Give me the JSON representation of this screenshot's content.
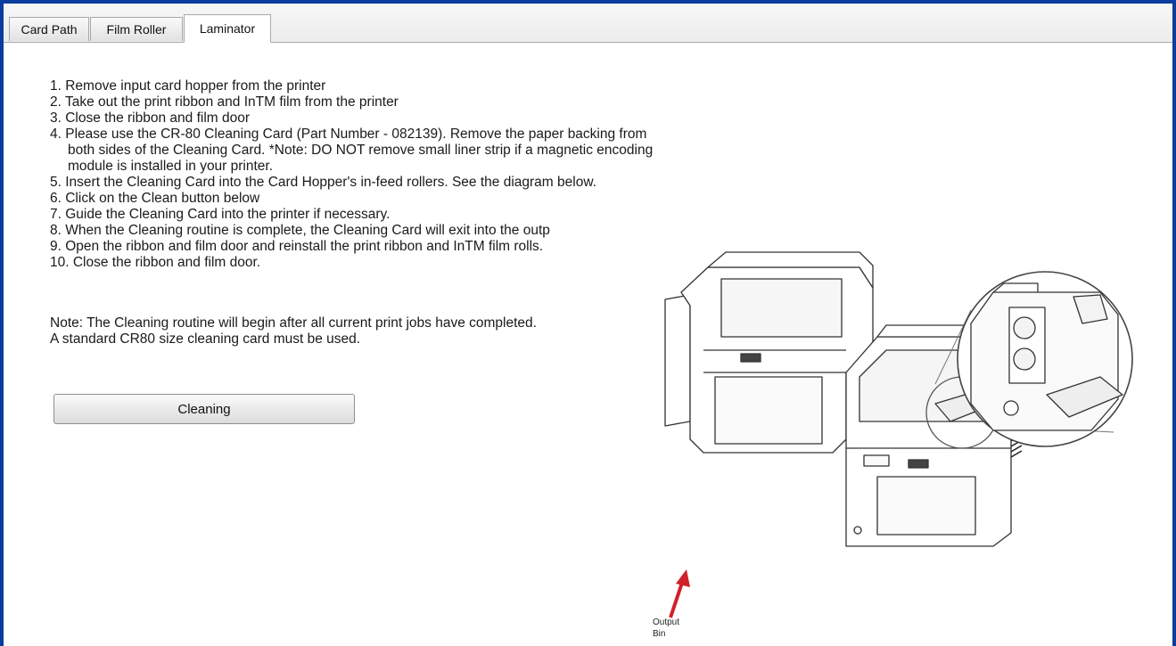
{
  "tabs": [
    {
      "label": "Card Path"
    },
    {
      "label": "Film Roller"
    },
    {
      "label": "Laminator"
    }
  ],
  "active_tab": "Laminator",
  "instructions": {
    "steps": [
      "1. Remove input card hopper from the printer",
      "2. Take out the print ribbon and InTM film from the printer",
      "3. Close the ribbon and film door",
      "4. Please use the CR-80 Cleaning Card (Part Number - 082139). Remove the paper backing from",
      "both sides of the Cleaning Card. *Note: DO NOT remove small liner strip if a magnetic encoding",
      "module is installed in your printer.",
      "5. Insert the Cleaning Card into the Card Hopper's in-feed rollers. See the diagram below.",
      "6. Click on the Clean button below",
      "7. Guide the Cleaning Card into the printer if necessary.",
      "8. When the Cleaning routine is complete, the Cleaning Card will exit into the outp",
      "9. Open the ribbon and film door and reinstall the print ribbon and InTM film rolls.",
      "10. Close the ribbon and film door."
    ],
    "note_line1": "Note: The Cleaning routine will begin after all current print jobs have completed.",
    "note_line2": "A standard CR80 size cleaning card must be used."
  },
  "cleaning_button": {
    "label": "Cleaning"
  },
  "illustration": {
    "caption_line1": "Output",
    "caption_line2": "Bin",
    "arrow_color": "#d0212a"
  },
  "colors": {
    "frame_border": "#0a3d9e"
  }
}
